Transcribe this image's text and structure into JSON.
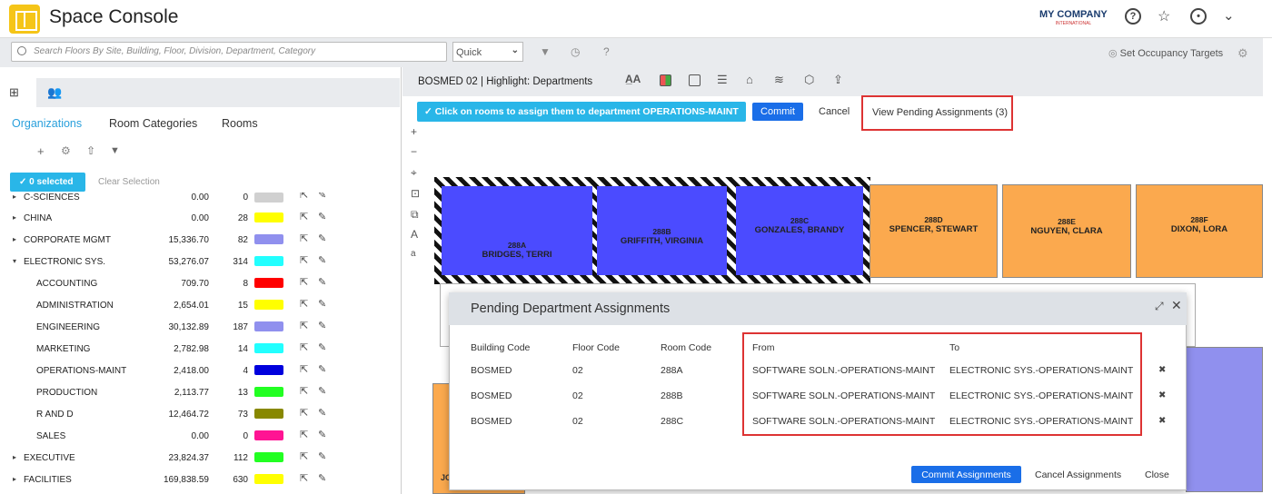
{
  "header": {
    "title": "Space Console",
    "company": "MY COMPANY",
    "company_sub": "INTERNATIONAL"
  },
  "search": {
    "placeholder": "Search Floors By Site, Building, Floor, Division, Department, Category",
    "quick": "Quick",
    "occupancy": "Set Occupancy Targets"
  },
  "left": {
    "tabs": [
      "Organizations",
      "Room Categories",
      "Rooms"
    ],
    "selected": "0 selected",
    "clear": "Clear Selection",
    "rows": [
      {
        "name": "C-SCIENCES",
        "area": "0.00",
        "count": "0",
        "color": "#d0d0d0",
        "indent": 0,
        "toggle": "▸",
        "partial": true
      },
      {
        "name": "CHINA",
        "area": "0.00",
        "count": "28",
        "color": "#ffff00",
        "indent": 0,
        "toggle": "▸"
      },
      {
        "name": "CORPORATE MGMT",
        "area": "15,336.70",
        "count": "82",
        "color": "#9090ee",
        "indent": 0,
        "toggle": "▸"
      },
      {
        "name": "ELECTRONIC SYS.",
        "area": "53,276.07",
        "count": "314",
        "color": "#22ffff",
        "indent": 0,
        "toggle": "▾"
      },
      {
        "name": "ACCOUNTING",
        "area": "709.70",
        "count": "8",
        "color": "#ff0000",
        "indent": 1,
        "toggle": ""
      },
      {
        "name": "ADMINISTRATION",
        "area": "2,654.01",
        "count": "15",
        "color": "#ffff00",
        "indent": 1,
        "toggle": ""
      },
      {
        "name": "ENGINEERING",
        "area": "30,132.89",
        "count": "187",
        "color": "#9090ee",
        "indent": 1,
        "toggle": ""
      },
      {
        "name": "MARKETING",
        "area": "2,782.98",
        "count": "14",
        "color": "#22ffff",
        "indent": 1,
        "toggle": ""
      },
      {
        "name": "OPERATIONS-MAINT",
        "area": "2,418.00",
        "count": "4",
        "color": "#0000dd",
        "indent": 1,
        "toggle": ""
      },
      {
        "name": "PRODUCTION",
        "area": "2,113.77",
        "count": "13",
        "color": "#22ff22",
        "indent": 1,
        "toggle": ""
      },
      {
        "name": "R AND D",
        "area": "12,464.72",
        "count": "73",
        "color": "#888800",
        "indent": 1,
        "toggle": ""
      },
      {
        "name": "SALES",
        "area": "0.00",
        "count": "0",
        "color": "#ff1493",
        "indent": 1,
        "toggle": ""
      },
      {
        "name": "EXECUTIVE",
        "area": "23,824.37",
        "count": "112",
        "color": "#22ff22",
        "indent": 0,
        "toggle": "▸"
      },
      {
        "name": "FACILITIES",
        "area": "169,838.59",
        "count": "630",
        "color": "#ffff00",
        "indent": 0,
        "toggle": "▸"
      }
    ]
  },
  "floor": {
    "title": "BOSMED 02 | Highlight: Departments",
    "assign_msg": "Click on rooms to assign them to department OPERATIONS-MAINT",
    "commit": "Commit",
    "cancel": "Cancel",
    "view_pending": "View Pending Assignments (3)",
    "rooms": [
      {
        "id": "288A",
        "occupant": "BRIDGES, TERRI"
      },
      {
        "id": "288B",
        "occupant": "GRIFFITH, VIRGINIA"
      },
      {
        "id": "288C",
        "occupant": "GONZALES, BRANDY"
      },
      {
        "id": "288D",
        "occupant": "SPENCER, STEWART"
      },
      {
        "id": "288E",
        "occupant": "NGUYEN, CLARA"
      },
      {
        "id": "288F",
        "occupant": "DIXON, LORA"
      }
    ],
    "partial_label": "JO"
  },
  "modal": {
    "title": "Pending Department Assignments",
    "headers": [
      "Building Code",
      "Floor Code",
      "Room Code",
      "From",
      "To"
    ],
    "rows": [
      {
        "building": "BOSMED",
        "floor": "02",
        "room": "288A",
        "from": "SOFTWARE SOLN.-OPERATIONS-MAINT",
        "to": "ELECTRONIC SYS.-OPERATIONS-MAINT"
      },
      {
        "building": "BOSMED",
        "floor": "02",
        "room": "288B",
        "from": "SOFTWARE SOLN.-OPERATIONS-MAINT",
        "to": "ELECTRONIC SYS.-OPERATIONS-MAINT"
      },
      {
        "building": "BOSMED",
        "floor": "02",
        "room": "288C",
        "from": "SOFTWARE SOLN.-OPERATIONS-MAINT",
        "to": "ELECTRONIC SYS.-OPERATIONS-MAINT"
      }
    ],
    "commit": "Commit Assignments",
    "cancel": "Cancel Assignments",
    "close": "Close"
  }
}
